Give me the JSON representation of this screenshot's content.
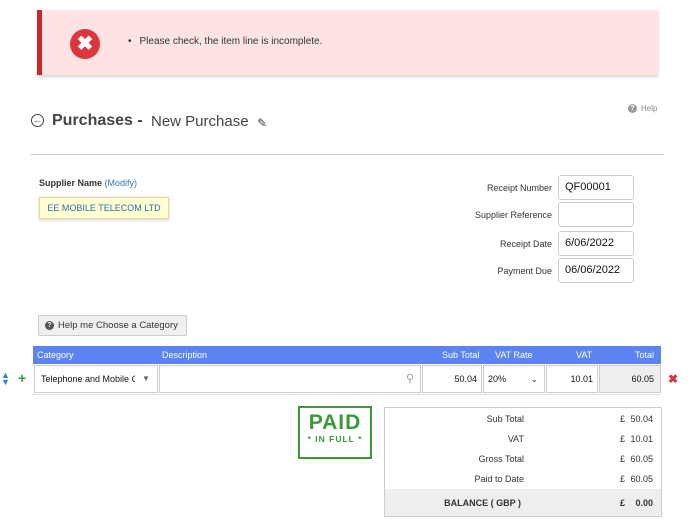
{
  "alert": {
    "message": "Please check, the item line is incomplete.",
    "icon": "close-circle-icon",
    "color": "#c8262d"
  },
  "help": {
    "label": "Help"
  },
  "header": {
    "title": "Purchases -",
    "subtitle": "New Purchase"
  },
  "supplier": {
    "label": "Supplier Name",
    "modify": "(Modify)",
    "name": "EE MOBILE TELECOM LTD"
  },
  "fields": [
    {
      "label": "Receipt Number",
      "value": "QF00001"
    },
    {
      "label": "Supplier Reference",
      "value": ""
    },
    {
      "label": "Receipt Date",
      "value": "6/06/2022"
    },
    {
      "label": "Payment Due",
      "value": "06/06/2022"
    }
  ],
  "category_help_button": "Help me Choose a Category",
  "table": {
    "headers": {
      "category": "Category",
      "description": "Description",
      "sub_total": "Sub Total",
      "vat_rate": "VAT Rate",
      "vat": "VAT",
      "total": "Total"
    },
    "header_color": "#5b84f0",
    "row": {
      "category": "Telephone and Mobile C",
      "description": "",
      "sub_total": "50.04",
      "vat_rate": "20%",
      "vat": "10.01",
      "total": "60.05"
    }
  },
  "stamp": {
    "main": "PAID",
    "sub": "* IN FULL *",
    "color": "#3a9a3a"
  },
  "totals": {
    "currency": "£",
    "rows": [
      {
        "label": "Sub Total",
        "value": "50.04"
      },
      {
        "label": "VAT",
        "value": "10.01"
      },
      {
        "label": "Gross Total",
        "value": "60.05"
      },
      {
        "label": "Paid to Date",
        "value": "60.05"
      }
    ],
    "balance_label": "BALANCE ( GBP )",
    "balance_value": "0.00"
  }
}
